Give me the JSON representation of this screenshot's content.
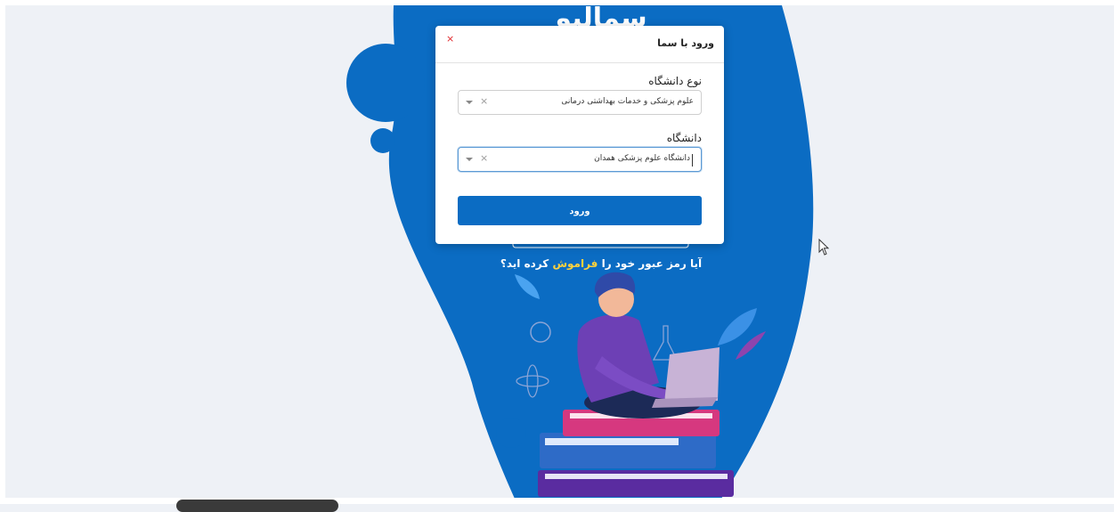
{
  "background": {
    "logo_text": "سمالیو",
    "forgot_prefix": "آیا رمز عبور خود را",
    "forgot_link": "فراموش",
    "forgot_suffix": "کرده اید؟"
  },
  "modal": {
    "title": "ورود با سما",
    "close_glyph": "×",
    "university_type_label": "نوع دانشگاه",
    "university_type_value": "علوم پزشکی و خدمات بهداشتی درمانی",
    "university_label": "دانشگاه",
    "university_value": "دانشگاه علوم پزشکی همدان",
    "clear_glyph": "×",
    "login_button": "ورود"
  },
  "colors": {
    "brand_blue": "#0b6cc3",
    "highlight_yellow": "#ffd23d",
    "close_red": "#e0262a"
  }
}
